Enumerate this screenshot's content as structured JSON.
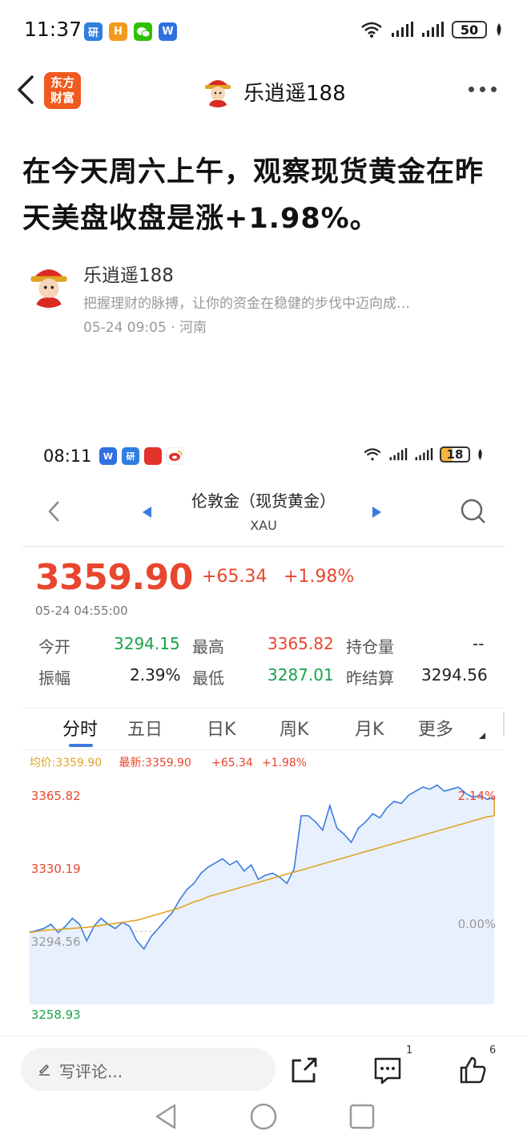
{
  "status_bar": {
    "time": "11:37",
    "battery": "50",
    "apps": [
      {
        "icon": "research-app-icon",
        "text": "研",
        "color": "#2f7de1"
      },
      {
        "icon": "h-app-icon",
        "text": "H",
        "color": "#f39a1e"
      },
      {
        "icon": "wechat-icon",
        "text": "",
        "color": "#2dc100"
      },
      {
        "icon": "w-app-icon",
        "text": "W",
        "color": "#2f6fe1"
      }
    ]
  },
  "header": {
    "logo_line1": "东方",
    "logo_line2": "财富",
    "author_name": "乐逍遥188"
  },
  "post": {
    "title": "在今天周六上午，观察现货黄金在昨天美盘收盘是涨+1.98%。",
    "author_name": "乐逍遥188",
    "author_desc": "把握理财的脉搏，让你的资金在稳健的步伐中迈向成…",
    "meta": "05-24 09:05 · 河南"
  },
  "embedded": {
    "status": {
      "time": "08:11",
      "battery": "18",
      "apps": [
        {
          "icon": "w-app-icon",
          "text": "W",
          "color": "#2f6fe1"
        },
        {
          "icon": "research-app-icon",
          "text": "研",
          "color": "#2f7de1"
        },
        {
          "icon": "news-app-icon",
          "text": "",
          "color": "#e2322b"
        },
        {
          "icon": "weibo-icon",
          "text": "",
          "color": "#f5a623"
        }
      ]
    },
    "nav": {
      "title": "伦敦金（现货黄金）",
      "subtitle": "XAU"
    },
    "quote": {
      "price": "3359.90",
      "change": "+65.34",
      "change_pct": "+1.98%",
      "time": "05-24 04:55:00"
    },
    "stats": {
      "open_label": "今开",
      "open": "3294.15",
      "high_label": "最高",
      "high": "3365.82",
      "oi_label": "持仓量",
      "oi": "--",
      "amp_label": "振幅",
      "amp": "2.39%",
      "low_label": "最低",
      "low": "3287.01",
      "settle_label": "昨结算",
      "settle": "3294.56"
    },
    "tabs": [
      "分时",
      "五日",
      "日K",
      "周K",
      "月K",
      "更多"
    ],
    "active_tab": "分时"
  },
  "chart_data": {
    "type": "line",
    "title": "",
    "legend": {
      "avg": "均价:3359.90",
      "latest": "最新:3359.90",
      "change": "+65.34",
      "pct": "+1.98%"
    },
    "y_ticks_left": [
      "3365.82",
      "3330.19",
      "3294.56",
      "3258.93"
    ],
    "y_ticks_right": [
      "2.14%",
      "0.00%"
    ],
    "ylim": [
      3258.93,
      3365.82
    ],
    "reference": 3294.56,
    "series": [
      {
        "name": "最新",
        "values": [
          3294,
          3295,
          3296,
          3298,
          3294,
          3297,
          3301,
          3298,
          3290,
          3297,
          3301,
          3298,
          3296,
          3299,
          3297,
          3290,
          3286,
          3292,
          3296,
          3300,
          3304,
          3310,
          3315,
          3318,
          3323,
          3326,
          3328,
          3330,
          3327,
          3329,
          3324,
          3327,
          3320,
          3322,
          3323,
          3321,
          3318,
          3325,
          3351,
          3351,
          3348,
          3344,
          3356,
          3345,
          3342,
          3338,
          3345,
          3348,
          3352,
          3350,
          3355,
          3358,
          3357,
          3361,
          3363,
          3365,
          3364,
          3366,
          3363,
          3364,
          3365,
          3362,
          3360,
          3361,
          3359,
          3359.9
        ]
      },
      {
        "name": "均价",
        "values": [
          3294,
          3294.5,
          3295,
          3295.3,
          3295.5,
          3295.8,
          3296,
          3296.3,
          3296.5,
          3297,
          3297.5,
          3298,
          3298.5,
          3299,
          3299.5,
          3300,
          3301,
          3302,
          3303,
          3304,
          3305,
          3306,
          3307.5,
          3309,
          3310,
          3311.5,
          3312.5,
          3313.5,
          3314.5,
          3315.5,
          3316.5,
          3317.5,
          3318.5,
          3319.5,
          3320.5,
          3321.5,
          3322.5,
          3323.5,
          3324.5,
          3325.5,
          3326.5,
          3327.5,
          3328.5,
          3329.5,
          3330.5,
          3331.5,
          3332.5,
          3333.5,
          3334.5,
          3335.5,
          3336.5,
          3337.5,
          3338.5,
          3339.5,
          3340.5,
          3341.5,
          3342.5,
          3343.5,
          3344.5,
          3345.5,
          3346.5,
          3347.5,
          3348.5,
          3349.5,
          3350.5,
          3351
        ]
      }
    ]
  },
  "bottom": {
    "comment_placeholder": "写评论...",
    "comment_count": "1",
    "like_count": "6"
  }
}
